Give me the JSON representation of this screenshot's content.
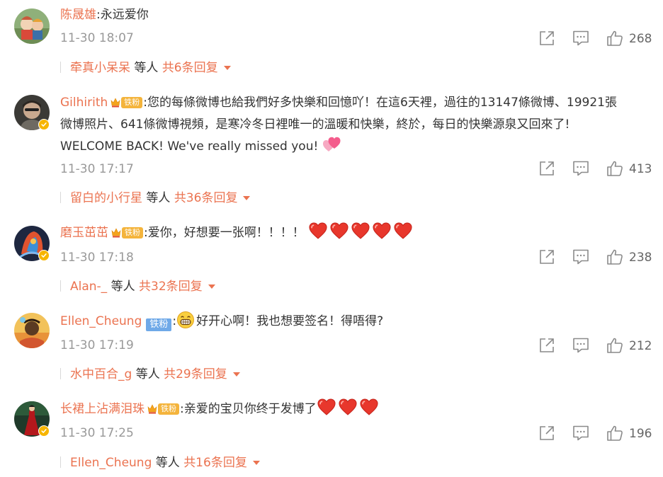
{
  "comments": [
    {
      "username": "陈晟雄",
      "has_fan_badge": false,
      "text": ":永远爱你",
      "time": "11-30 18:07",
      "likes": "268",
      "reply_user": "牵真小呆呆",
      "reply_mid": " 等人 ",
      "reply_count": "共6条回复"
    },
    {
      "username": "Gilhirith",
      "fan_badge": "铁粉",
      "text_line1": ":您的每條微博也給我們好多快樂和回憶吖！在這6天裡，過往的13147條微博、19921張",
      "text_line2": "微博照片、641條微博視頻，是寒冷冬日裡唯一的溫暖和快樂，終於，每日的快樂源泉又回來了!",
      "text_line3": "WELCOME BACK! We've really missed you!",
      "time": "11-30 17:17",
      "likes": "413",
      "reply_user": "留白的小行星",
      "reply_mid": " 等人 ",
      "reply_count": "共36条回复"
    },
    {
      "username": "磨玉茁茁",
      "fan_badge": "铁粉",
      "text": ":爱你，好想要一张啊！！！！",
      "time": "11-30 17:18",
      "likes": "238",
      "reply_user": "Alan-_",
      "reply_mid": " 等人 ",
      "reply_count": "共32条回复"
    },
    {
      "username": "Ellen_Cheung",
      "fan_badge": "铁粉",
      "text_prefix": ":",
      "text": "好开心啊！我也想要签名！得唔得?",
      "time": "11-30 17:19",
      "likes": "212",
      "reply_user": "水中百合_g",
      "reply_mid": " 等人 ",
      "reply_count": "共29条回复"
    },
    {
      "username": "长裙上沾满泪珠",
      "fan_badge": "铁粉",
      "text": ":亲爱的宝贝你终于发博了",
      "time": "11-30 17:25",
      "likes": "196",
      "reply_user": "Ellen_Cheung",
      "reply_mid": " 等人 ",
      "reply_count": "共16条回复"
    }
  ],
  "colors": {
    "username": "#eb7350",
    "text": "#333333",
    "time": "#999999",
    "icon": "#8a8a8a",
    "fan_badge": "#f4b43c",
    "fan_badge_blue": "#6fa9e8",
    "verified": "#f7b500"
  },
  "icons": {
    "share": "share-icon",
    "comment": "comment-icon",
    "like": "thumbs-up-icon",
    "caret": "caret-down-icon",
    "verified": "verified-badge-icon",
    "heart": "red-heart-icon"
  }
}
